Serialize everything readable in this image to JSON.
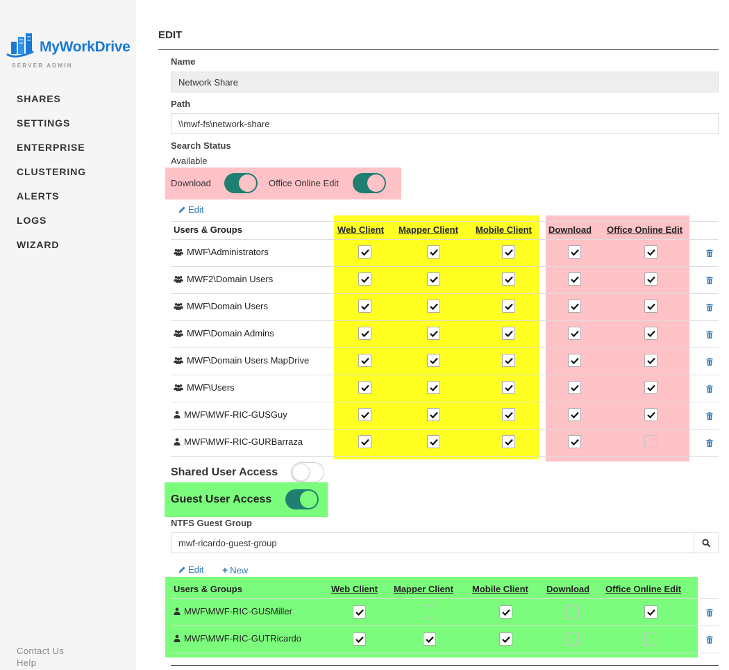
{
  "brand": {
    "name": "MyWorkDrive",
    "subtitle": "SERVER ADMIN"
  },
  "nav": [
    {
      "label": "SHARES"
    },
    {
      "label": "SETTINGS"
    },
    {
      "label": "ENTERPRISE"
    },
    {
      "label": "CLUSTERING"
    },
    {
      "label": "ALERTS"
    },
    {
      "label": "LOGS"
    },
    {
      "label": "WIZARD"
    }
  ],
  "footer": {
    "contact": "Contact Us",
    "help": "Help"
  },
  "page": {
    "heading": "EDIT"
  },
  "form": {
    "name_label": "Name",
    "name_value": "Network Share",
    "path_label": "Path",
    "path_value": "\\\\mwf-fs\\network-share",
    "search_status_label": "Search Status",
    "search_status_value": "Available",
    "download_label": "Download",
    "download_on": true,
    "office_label": "Office Online Edit",
    "office_on": true
  },
  "permissions": {
    "edit_label": "Edit",
    "columns": [
      "Users & Groups",
      "Web Client",
      "Mapper Client",
      "Mobile Client",
      "Download",
      "Office Online Edit"
    ],
    "rows": [
      {
        "name": "MWF\\Administrators",
        "icon": "users-icon",
        "checks": [
          true,
          true,
          true,
          true,
          true
        ]
      },
      {
        "name": "MWF2\\Domain Users",
        "icon": "users-icon",
        "checks": [
          true,
          true,
          true,
          true,
          true
        ]
      },
      {
        "name": "MWF\\Domain Users",
        "icon": "users-icon",
        "checks": [
          true,
          true,
          true,
          true,
          true
        ]
      },
      {
        "name": "MWF\\Domain Admins",
        "icon": "users-icon",
        "checks": [
          true,
          true,
          true,
          true,
          true
        ]
      },
      {
        "name": "MWF\\Domain Users MapDrive",
        "icon": "users-icon",
        "checks": [
          true,
          true,
          true,
          true,
          true
        ]
      },
      {
        "name": "MWF\\Users",
        "icon": "users-icon",
        "checks": [
          true,
          true,
          true,
          true,
          true
        ]
      },
      {
        "name": "MWF\\MWF-RIC-GUSGuy",
        "icon": "user-icon",
        "checks": [
          true,
          true,
          true,
          true,
          true
        ]
      },
      {
        "name": "MWF\\MWF-RIC-GURBarraza",
        "icon": "user-icon",
        "checks": [
          true,
          true,
          true,
          true,
          false
        ]
      }
    ]
  },
  "shared_access": {
    "label": "Shared User Access",
    "on": false
  },
  "guest_access": {
    "label": "Guest User Access",
    "on": true
  },
  "guest_group": {
    "label": "NTFS Guest Group",
    "value": "mwf-ricardo-guest-group"
  },
  "guest_permissions": {
    "edit_label": "Edit",
    "new_label": "New",
    "columns": [
      "Users & Groups",
      "Web Client",
      "Mapper Client",
      "Mobile Client",
      "Download",
      "Office Online Edit"
    ],
    "rows": [
      {
        "name": "MWF\\MWF-RIC-GUSMiller",
        "icon": "user-icon",
        "checks": [
          true,
          false,
          true,
          false,
          true
        ]
      },
      {
        "name": "MWF\\MWF-RIC-GUTRicardo",
        "icon": "user-icon",
        "checks": [
          true,
          true,
          true,
          false,
          false
        ]
      }
    ]
  },
  "colors": {
    "accent": "#1f7f70",
    "link": "#337ab7",
    "brand": "#1a7ad4",
    "highlight_pink": "#ffc2c6",
    "highlight_yellow": "#ffff22",
    "highlight_green": "#7cfc7c"
  }
}
